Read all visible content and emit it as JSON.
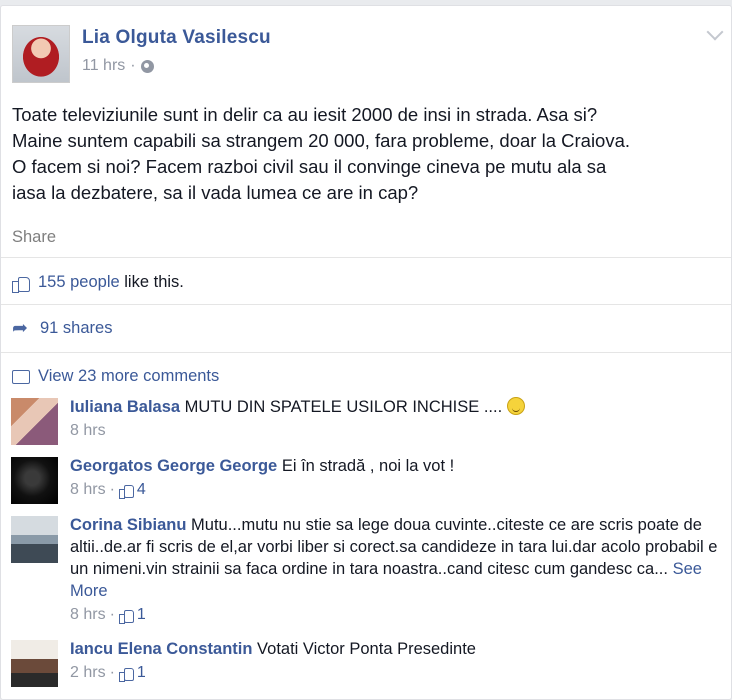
{
  "post": {
    "author": "Lia Olguta Vasilescu",
    "time": "11 hrs",
    "separator": "·",
    "text": "Toate televiziunile sunt in delir ca au iesit 2000 de insi in strada. Asa si?\nMaine suntem capabili sa strangem 20 000, fara probleme, doar la Craiova.\nO facem si noi? Facem razboi civil sau il convinge cineva pe mutu ala sa\niasa la dezbatere, sa il vada lumea ce are in cap?",
    "share_label": "Share"
  },
  "stats": {
    "likes_count_text": "155 people",
    "likes_suffix": "like this.",
    "shares_text": "91 shares",
    "more_comments_text": "View 23 more comments"
  },
  "comments": [
    {
      "name": "Iuliana Balasa",
      "text": "MUTU DIN SPATELE USILOR INCHISE ....",
      "time": "8 hrs",
      "likes": ""
    },
    {
      "name": "Georgatos George George",
      "text": "Ei în stradă , noi la vot !",
      "time": "8 hrs",
      "likes": "4"
    },
    {
      "name": "Corina Sibianu",
      "text": "Mutu...mutu nu stie sa lege doua cuvinte..citeste ce are scris poate de altii..de.ar fi scris de el,ar vorbi liber si corect.sa candideze in tara lui.dar acolo probabil e un nimeni.vin strainii sa faca ordine in tara noastra..cand citesc cum gandesc ca...",
      "see_more": "See More",
      "time": "8 hrs",
      "likes": "1"
    },
    {
      "name": "Iancu Elena Constantin",
      "text": "Votati Victor Ponta Presedinte",
      "time": "2 hrs",
      "likes": "1"
    }
  ],
  "icons": {
    "like": "thumbs-up-icon",
    "share": "share-arrow-icon",
    "comment": "comment-bubble-icon",
    "globe": "globe-icon",
    "chevron": "chevron-down-icon",
    "smiley": "smiley-icon"
  },
  "colors": {
    "link": "#3b5998",
    "meta": "#9197a3",
    "text": "#141823"
  }
}
